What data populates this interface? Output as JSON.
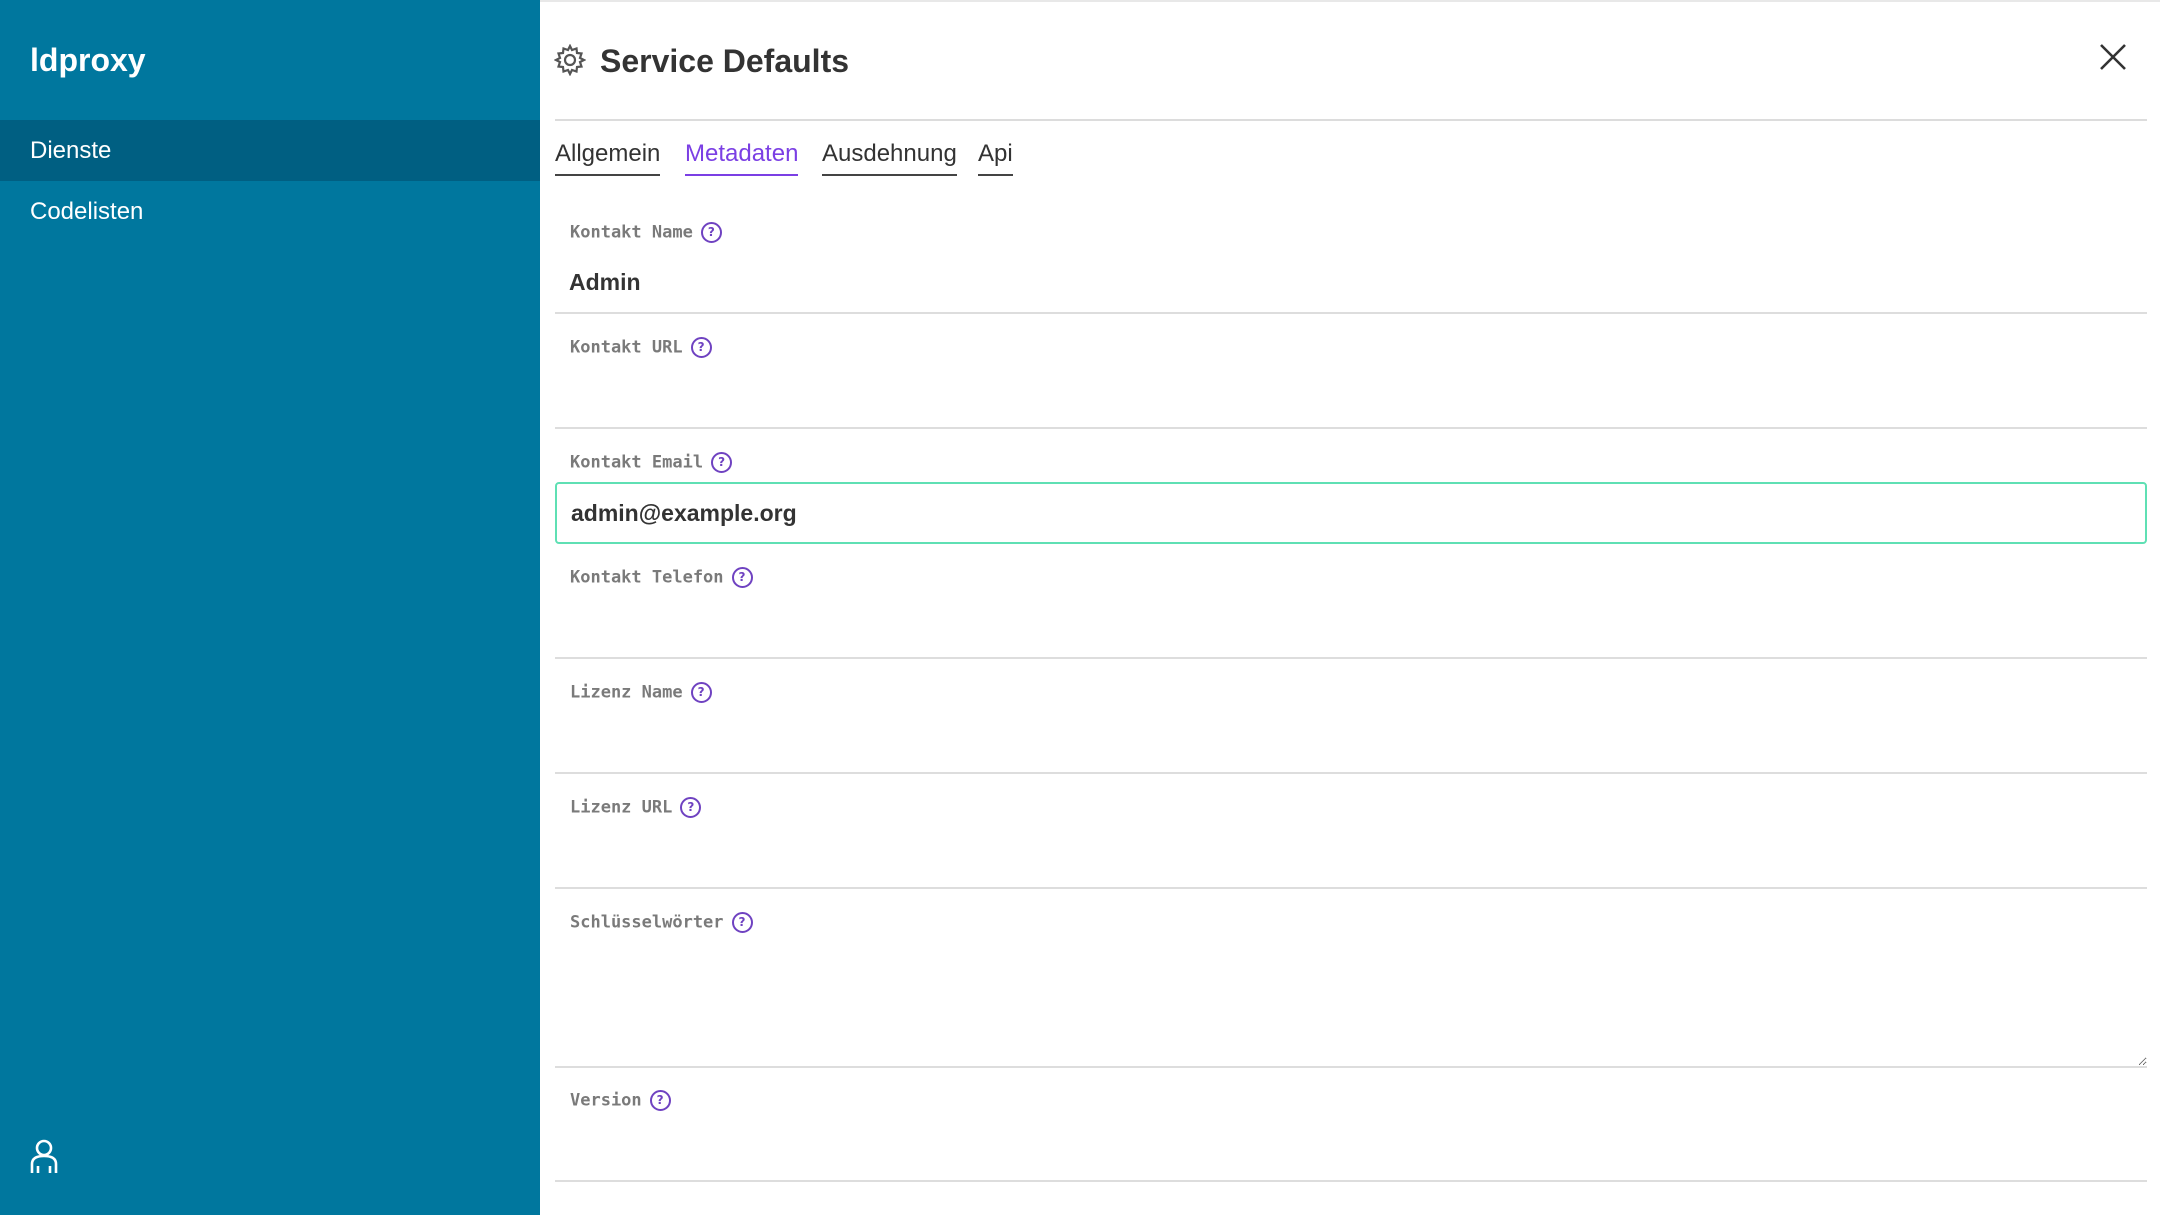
{
  "app": {
    "title": "ldproxy"
  },
  "sidebar": {
    "items": [
      {
        "label": "Dienste",
        "active": true
      },
      {
        "label": "Codelisten",
        "active": false
      }
    ],
    "user_icon": "user-icon",
    "bg_color": "#00779e",
    "active_color": "#005f82"
  },
  "header": {
    "icon": "gear-icon",
    "title": "Service Defaults",
    "close_icon": "close-icon"
  },
  "tabs": [
    {
      "label": "Allgemein",
      "active": false
    },
    {
      "label": "Metadaten",
      "active": true
    },
    {
      "label": "Ausdehnung",
      "active": false
    },
    {
      "label": "Api",
      "active": false
    }
  ],
  "accent_color": "#7b3fe4",
  "focus_color": "#5fe0b4",
  "help_icon_glyph": "?",
  "form": {
    "contact_name": {
      "label": "Kontakt Name",
      "value": "Admin"
    },
    "contact_url": {
      "label": "Kontakt URL",
      "value": ""
    },
    "contact_email": {
      "label": "Kontakt Email",
      "value": "admin@example.org",
      "focused": true
    },
    "contact_phone": {
      "label": "Kontakt Telefon",
      "value": ""
    },
    "license_name": {
      "label": "Lizenz Name",
      "value": ""
    },
    "license_url": {
      "label": "Lizenz URL",
      "value": ""
    },
    "keywords": {
      "label": "Schlüsselwörter",
      "value": ""
    },
    "version": {
      "label": "Version",
      "value": ""
    }
  }
}
